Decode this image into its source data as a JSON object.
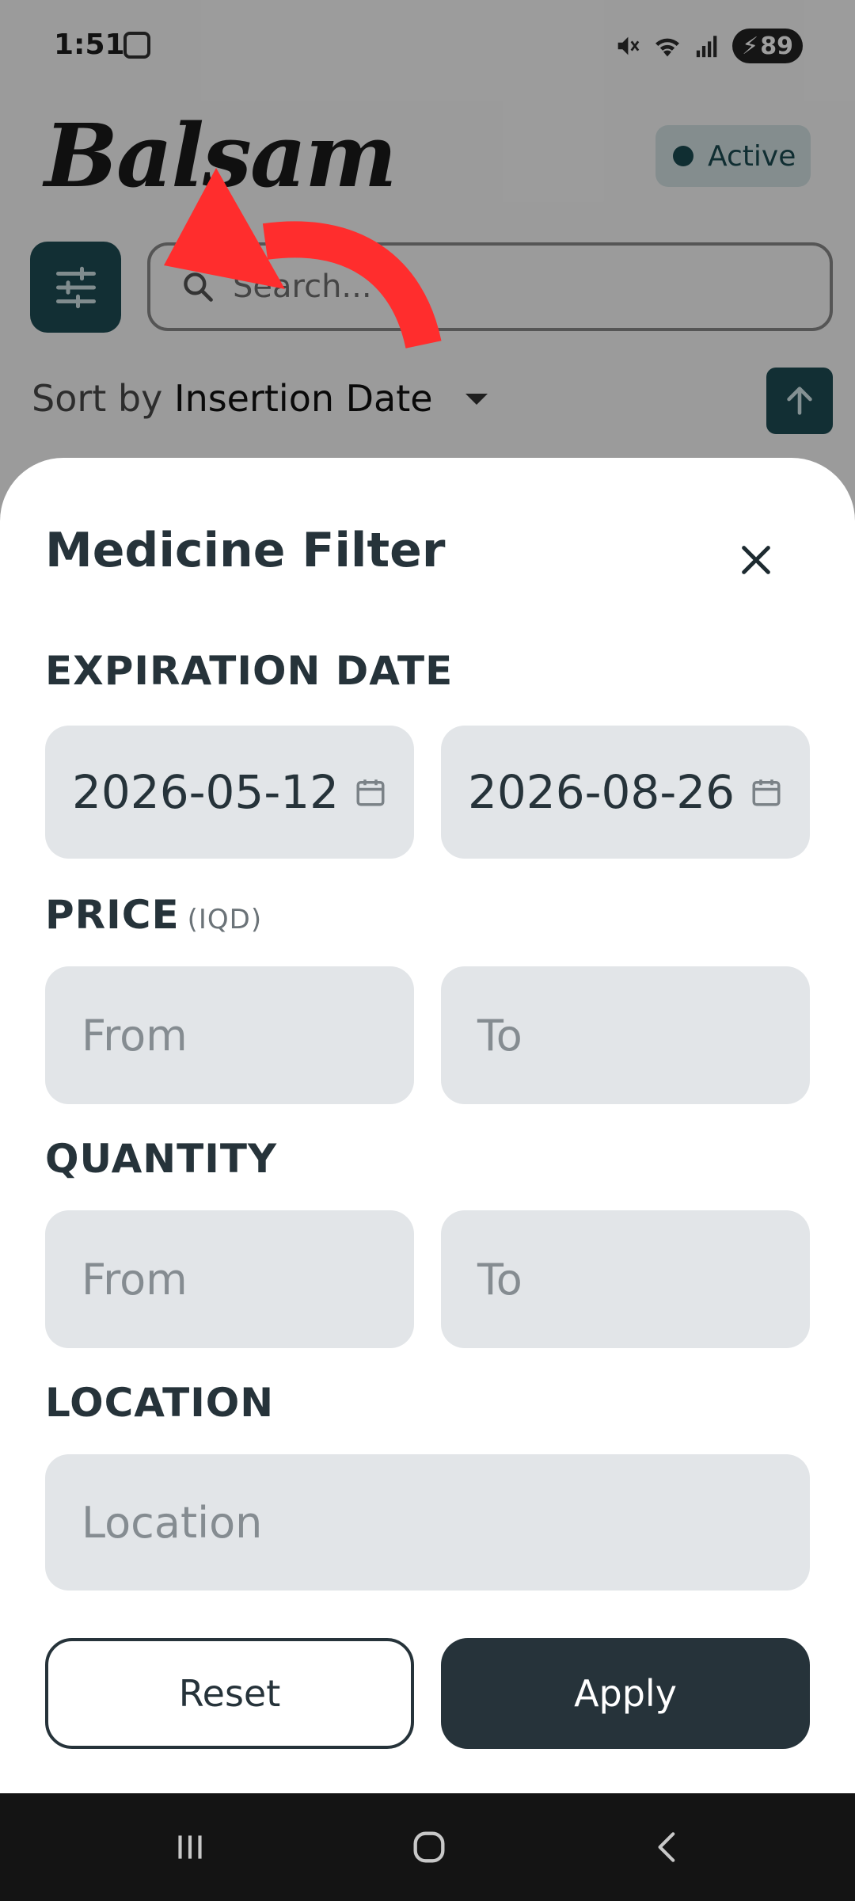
{
  "status_bar": {
    "time": "1:51",
    "battery": "89"
  },
  "app": {
    "brand": "Balsam",
    "status_badge": "Active",
    "search_placeholder": "Search...",
    "sort_label": "Sort by",
    "sort_value": "Insertion Date"
  },
  "sheet": {
    "title": "Medicine Filter",
    "expiration": {
      "label": "EXPIRATION DATE",
      "from_value": "2026-05-12",
      "to_value": "2026-08-26"
    },
    "price": {
      "label": "PRICE",
      "unit": "(IQD)",
      "from_placeholder": "From",
      "to_placeholder": "To"
    },
    "quantity": {
      "label": "QUANTITY",
      "from_placeholder": "From",
      "to_placeholder": "To"
    },
    "location": {
      "label": "LOCATION",
      "placeholder": "Location"
    },
    "reset_label": "Reset",
    "apply_label": "Apply"
  },
  "colors": {
    "accent": "#1e4c54",
    "dark": "#26333a",
    "field_bg": "#e2e5e8",
    "hint_arrow": "#ff2d2d"
  },
  "icons": [
    "screen-record-icon",
    "mute-icon",
    "wifi-icon",
    "signal-icon",
    "battery-icon",
    "filter-sliders-icon",
    "search-icon",
    "chevron-down-icon",
    "arrow-up-icon",
    "close-icon",
    "calendar-icon",
    "recents-icon",
    "home-icon",
    "back-icon"
  ]
}
